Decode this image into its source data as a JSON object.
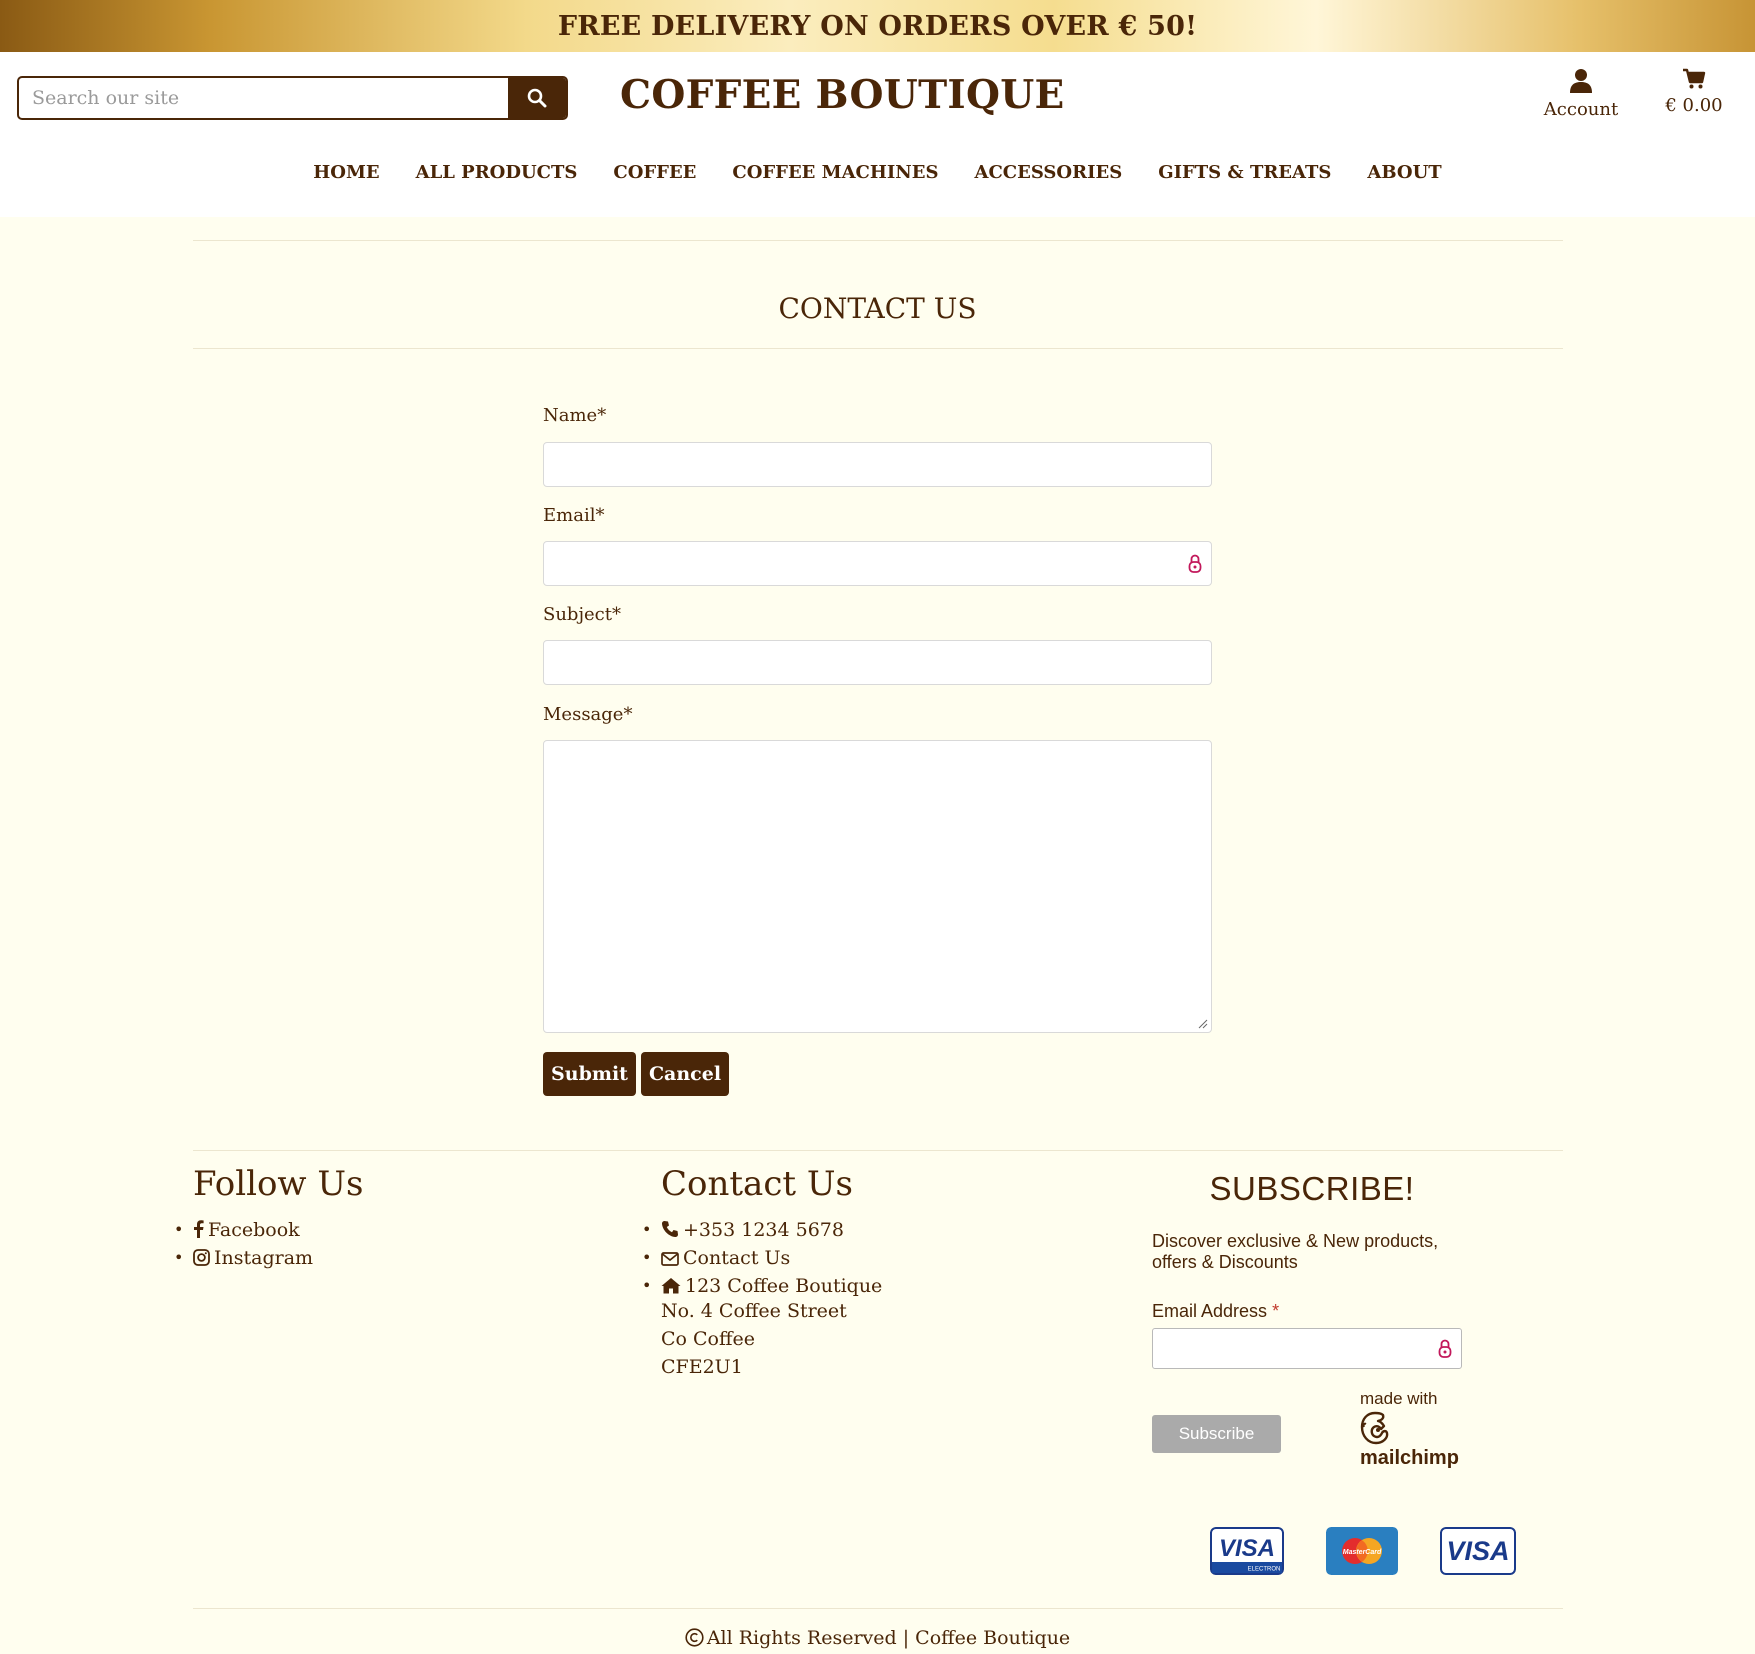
{
  "banner": {
    "text": "FREE DELIVERY ON ORDERS OVER € 50!"
  },
  "header": {
    "search_placeholder": "Search our site",
    "brand": "COFFEE BOUTIQUE",
    "account_label": "Account",
    "cart_total": "€ 0.00"
  },
  "nav": {
    "items": [
      {
        "label": "HOME"
      },
      {
        "label": "ALL PRODUCTS"
      },
      {
        "label": "COFFEE"
      },
      {
        "label": "COFFEE MACHINES"
      },
      {
        "label": "ACCESSORIES"
      },
      {
        "label": "GIFTS & TREATS"
      },
      {
        "label": "ABOUT"
      }
    ]
  },
  "page": {
    "title": "CONTACT US"
  },
  "form": {
    "name_label": "Name*",
    "name_value": "",
    "email_label": "Email*",
    "email_value": "",
    "subject_label": "Subject*",
    "subject_value": "",
    "message_label": "Message*",
    "message_value": "",
    "submit_label": "Submit",
    "cancel_label": "Cancel"
  },
  "footer": {
    "follow": {
      "title": "Follow Us",
      "items": [
        {
          "label": "Facebook"
        },
        {
          "label": "Instagram"
        }
      ]
    },
    "contact": {
      "title": "Contact Us",
      "phone": "+353 1234 5678",
      "contact_link": "Contact Us",
      "address_lines": [
        "123 Coffee Boutique",
        "No. 4 Coffee Street",
        "Co Coffee",
        "CFE2U1"
      ]
    },
    "subscribe": {
      "title": "SUBSCRIBE!",
      "text": "Discover exclusive & New products, offers & Discounts",
      "email_label": "Email Address",
      "required_mark": "*",
      "email_value": "",
      "button_label": "Subscribe",
      "made_with": "made with",
      "mailchimp": "mailchimp"
    },
    "payment_cards": [
      "VISA ELECTRON",
      "MASTERCARD",
      "VISA"
    ],
    "copyright": "All Rights Reserved | Coffee Boutique"
  },
  "colors": {
    "brown": "#4a2608",
    "page_bg": "#fffeef",
    "header_bg": "#ffffff",
    "subscribe_button": "#aaaaaa"
  }
}
